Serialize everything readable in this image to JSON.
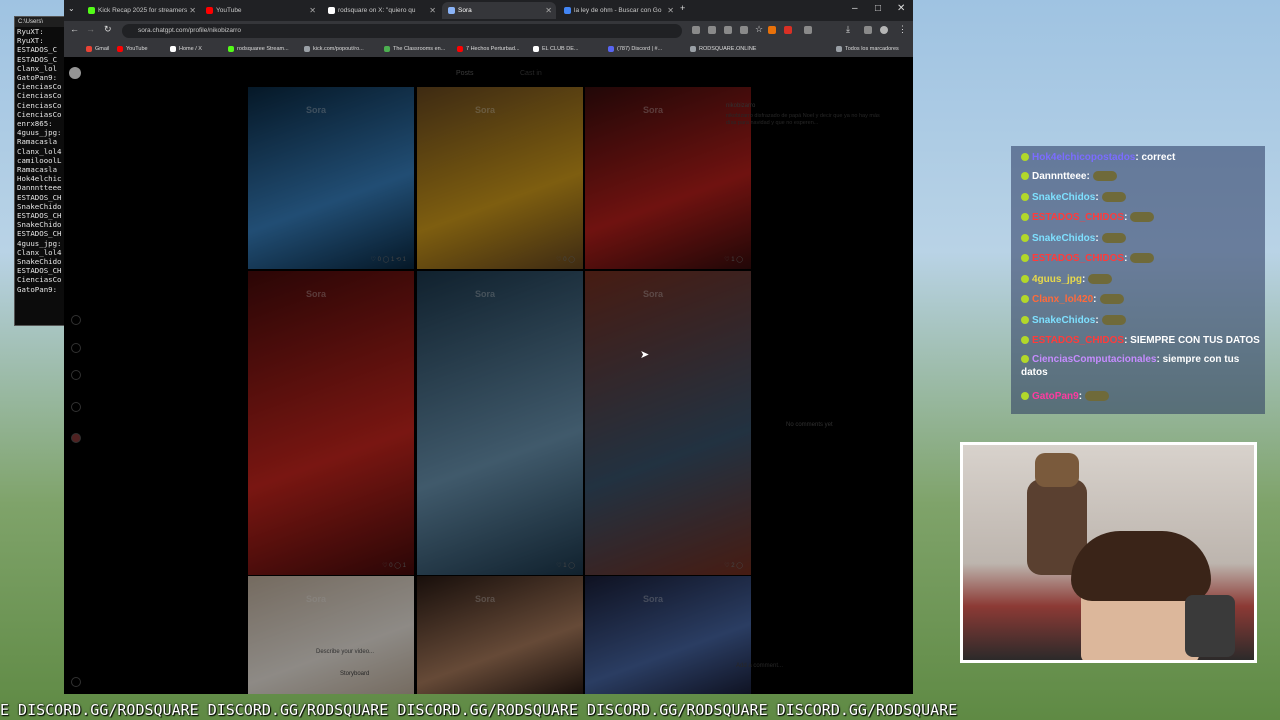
{
  "terminal": {
    "title": "C:\\Users\\",
    "lines": [
      "RyuXT:",
      "RyuXT:",
      "ESTADOS_C",
      "ESTADOS_C",
      "Clanx_lol",
      "GatoPan9:",
      "CienciasCo",
      "CienciasCo",
      "CienciasCo",
      "CienciasCo",
      "enrx865: ",
      "4guus_jpg:",
      "Ramacasla",
      "Clanx_lol4",
      "camilooolL",
      "Ramacasla",
      "Hok4elchic",
      "Dannntteee",
      "ESTADOS_CH",
      "SnakeChido",
      "ESTADOS_CH",
      "SnakeChido",
      "ESTADOS_CH",
      "4guus_jpg:",
      "Clanx_lol4",
      "SnakeChido",
      "ESTADOS_CH",
      "CienciasCo",
      "GatoPan9:"
    ]
  },
  "browser": {
    "tabs": [
      {
        "label": "Kick Recap 2025 for streamers",
        "color": "#53fc18"
      },
      {
        "label": "YouTube",
        "color": "#ff0000"
      },
      {
        "label": "rodsquare on X: \"quiero qu",
        "color": "#ffffff"
      },
      {
        "label": "Sora",
        "color": "#8ab4f8"
      },
      {
        "label": "la ley de ohm - Buscar con Go",
        "color": "#4285f4"
      }
    ],
    "url": "sora.chatgpt.com/profile/nikobizarro",
    "new_tab": "+",
    "bookmarks": [
      {
        "label": "Gmail",
        "color": "#ea4335"
      },
      {
        "label": "YouTube",
        "color": "#ff0000"
      },
      {
        "label": "Home / X",
        "color": "#ffffff"
      },
      {
        "label": "rodsquaree Stream...",
        "color": "#53fc18"
      },
      {
        "label": "kick.com/popout/ro...",
        "color": "#9aa0a6"
      },
      {
        "label": "The Classrooms en...",
        "color": "#4caf50"
      },
      {
        "label": "7 Hechos Perturbad...",
        "color": "#ff0000"
      },
      {
        "label": "EL CLUB DE...",
        "color": "#ffffff"
      },
      {
        "label": "(787) Discord | #...",
        "color": "#5865f2"
      },
      {
        "label": "RODSQUARE.ONLINE",
        "color": "#9aa0a6"
      }
    ],
    "all_bookmarks": "Todos los marcadores"
  },
  "sora": {
    "tabs": [
      "Posts",
      "Cast in"
    ],
    "post_user": "nikobizarro",
    "post_caption": "nikobizarro disfrazado de papá Noel y decir que ya no hay más días para navidad y que no esperen...",
    "no_comments": "No comments yet",
    "add_comment": "Add a comment...",
    "describe_placeholder": "Describe your video...",
    "storyboard": "Storyboard",
    "watermark": "Sora",
    "tiles": [
      {
        "stats": "♡ 0  ◯ 1  ⟲ 1",
        "colors": [
          "#0a2a44",
          "#3a86c8"
        ]
      },
      {
        "stats": "♡ 0  ◯",
        "colors": [
          "#6b4a20",
          "#d9a21c"
        ]
      },
      {
        "stats": "♡ 1  ◯",
        "colors": [
          "#3a0d0d",
          "#c0201c"
        ]
      },
      {
        "stats": "♡ 0  ◯ 1",
        "colors": [
          "#4a0b0b",
          "#d1271f"
        ]
      },
      {
        "stats": "♡ 1  ◯",
        "colors": [
          "#1d3a50",
          "#6f9bb9"
        ]
      },
      {
        "stats": "♡ 2  ◯",
        "colors": [
          "#7a3020",
          "#3b5670"
        ]
      },
      {
        "stats": "",
        "colors": [
          "#c9b8a5",
          "#f4eee6"
        ]
      },
      {
        "stats": "",
        "colors": [
          "#2a1a14",
          "#b08060"
        ]
      },
      {
        "stats": "",
        "colors": [
          "#1a1f3a",
          "#4a6aaa"
        ]
      }
    ]
  },
  "chat": {
    "messages": [
      {
        "user": "Hok4elchicopostados",
        "text": ": correct",
        "color": "#7b6cff",
        "emote": false
      },
      {
        "user": "Dannntteee",
        "text": ":",
        "color": "#ffffff",
        "emote": true
      },
      {
        "user": "SnakeChidos",
        "text": ":",
        "color": "#7ee0ff",
        "emote": true
      },
      {
        "user": "ESTADOS_CHIDOS",
        "text": ":",
        "color": "#ff3b3b",
        "emote": true
      },
      {
        "user": "SnakeChidos",
        "text": ":",
        "color": "#7ee0ff",
        "emote": true
      },
      {
        "user": "ESTADOS_CHIDOS",
        "text": ":",
        "color": "#ff3b3b",
        "emote": true
      },
      {
        "user": "4guus_jpg",
        "text": ":",
        "color": "#e8d94a",
        "emote": true
      },
      {
        "user": "Clanx_lol420",
        "text": ":",
        "color": "#ff6a3b",
        "emote": true
      },
      {
        "user": "SnakeChidos",
        "text": ":",
        "color": "#7ee0ff",
        "emote": true
      },
      {
        "user": "ESTADOS_CHIDOS",
        "text": ": SIEMPRE CON TUS DATOS",
        "color": "#ff3b3b",
        "emote": false
      },
      {
        "user": "CienciasComputacionales",
        "text": ": siempre con tus datos",
        "color": "#c68cff",
        "emote": false
      },
      {
        "user": "GatoPan9",
        "text": ":",
        "color": "#ff3ba0",
        "emote": true
      }
    ]
  },
  "ticker": "E DISCORD.GG/RODSQUARE DISCORD.GG/RODSQUARE DISCORD.GG/RODSQUARE DISCORD.GG/RODSQUARE DISCORD.GG/RODSQUARE"
}
